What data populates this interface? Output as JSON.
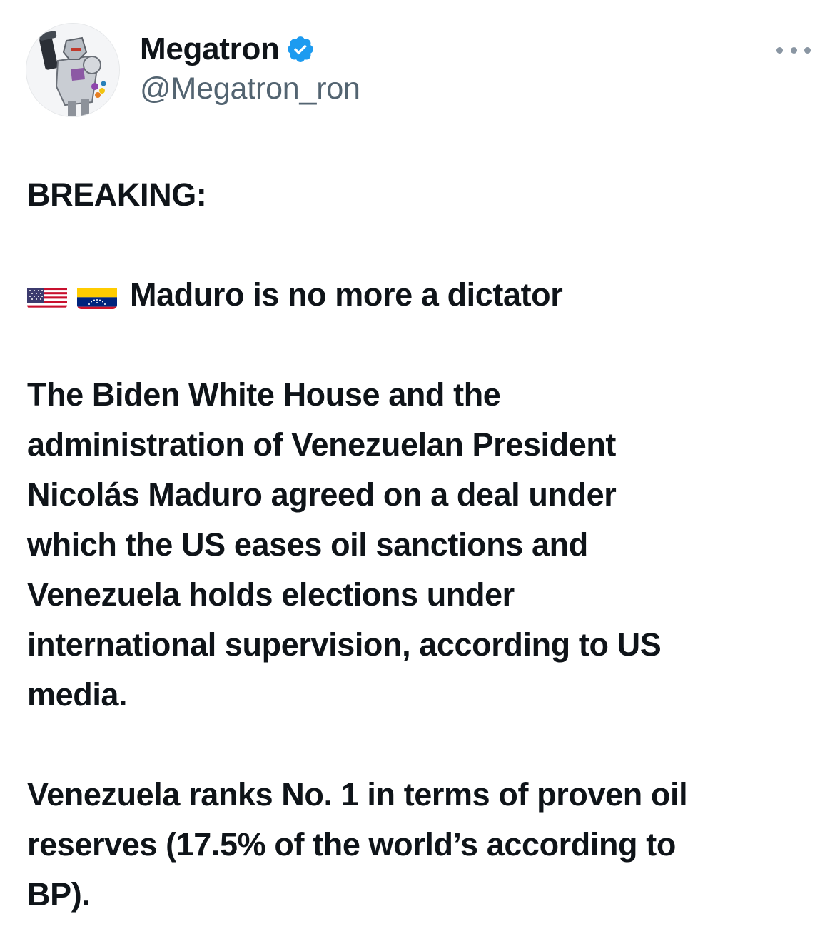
{
  "author": {
    "display_name": "Megatron",
    "handle": "@Megatron_ron",
    "verified": true,
    "verified_badge_color": "#1d9bf0",
    "avatar_icon": "megatron-avatar-icon"
  },
  "menu": {
    "icon": "more-options-icon"
  },
  "tweet": {
    "heading": "BREAKING:",
    "flags": [
      "us-flag-icon",
      "venezuela-flag-icon"
    ],
    "headline": "Maduro is no more a dictator",
    "paragraph_lines": [
      "The Biden White House and the",
      "administration of Venezuelan President",
      "Nicolás Maduro agreed on a deal under",
      "which the US eases oil sanctions and",
      "Venezuela holds elections under",
      "international supervision, according to US",
      "media."
    ],
    "closing_lines": [
      "Venezuela ranks No. 1 in terms of proven oil",
      "reserves (17.5% of the world’s according to",
      "BP)."
    ]
  }
}
